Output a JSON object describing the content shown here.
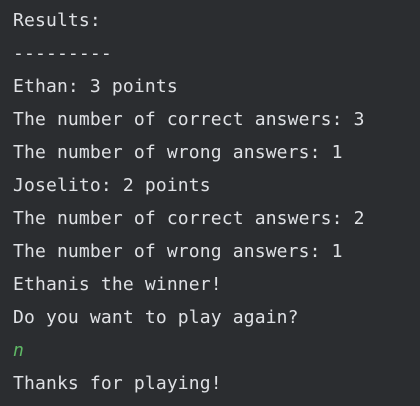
{
  "console": {
    "lines": [
      {
        "text": "Results:",
        "kind": "output"
      },
      {
        "text": "---------",
        "kind": "output"
      },
      {
        "text": "Ethan: 3 points",
        "kind": "output"
      },
      {
        "text": "The number of correct answers: 3",
        "kind": "output"
      },
      {
        "text": "The number of wrong answers: 1",
        "kind": "output"
      },
      {
        "text": "Joselito: 2 points",
        "kind": "output"
      },
      {
        "text": "The number of correct answers: 2",
        "kind": "output"
      },
      {
        "text": "The number of wrong answers: 1",
        "kind": "output"
      },
      {
        "text": "Ethanis the winner!",
        "kind": "output"
      },
      {
        "text": "Do you want to play again?",
        "kind": "output"
      },
      {
        "text": "n",
        "kind": "input"
      },
      {
        "text": "Thanks for playing!",
        "kind": "output"
      }
    ]
  },
  "colors": {
    "background": "#2b2d30",
    "output_text": "#dfe1e5",
    "user_input_text": "#5fb865"
  }
}
